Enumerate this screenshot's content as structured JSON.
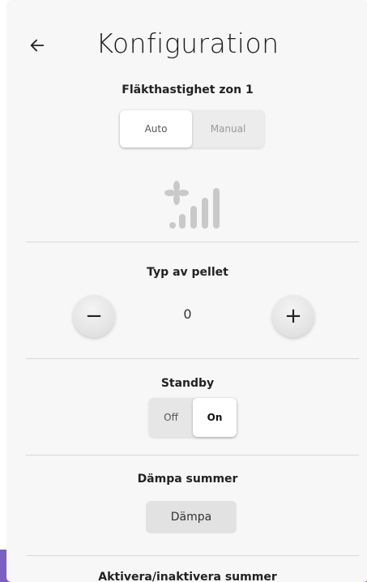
{
  "header": {
    "title": "Konfiguration",
    "back_icon": "arrow-left-icon"
  },
  "fan_speed": {
    "label": "Fläkthastighet zon 1",
    "options": [
      "Auto",
      "Manual"
    ],
    "selected": "Auto",
    "icon": "fan-speed-icon"
  },
  "pellet_type": {
    "label": "Typ av pellet",
    "value": "0",
    "minus_label": "−",
    "plus_label": "+"
  },
  "standby": {
    "label": "Standby",
    "off_label": "Off",
    "on_label": "On",
    "selected": "On"
  },
  "mute_buzzer": {
    "label": "Dämpa summer",
    "button_label": "Dämpa"
  },
  "toggle_buzzer": {
    "label": "Aktivera/inaktivera summer"
  },
  "colors": {
    "accent": "#7b5fc4",
    "panel": "#f7f7f7",
    "divider": "#d9d9d9"
  }
}
